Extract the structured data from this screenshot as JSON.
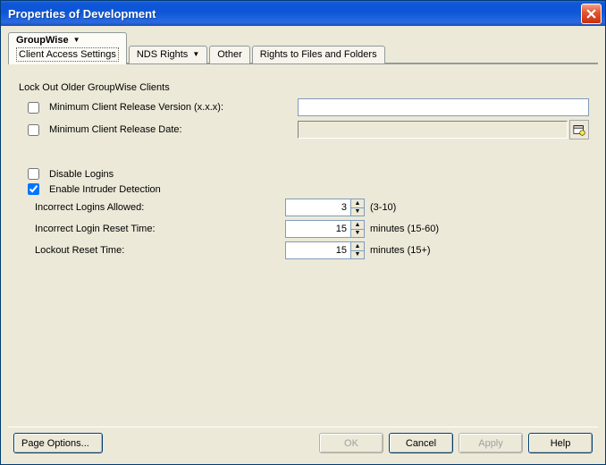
{
  "window": {
    "title": "Properties of Development"
  },
  "tabs": {
    "groupwise": {
      "label": "GroupWise",
      "subline": "Client Access Settings"
    },
    "nds": {
      "label": "NDS Rights"
    },
    "other": {
      "label": "Other"
    },
    "rights": {
      "label": "Rights to Files and Folders"
    }
  },
  "section": {
    "lockout_title": "Lock Out Older GroupWise Clients",
    "min_version_label": "Minimum Client Release Version (x.x.x):",
    "min_date_label": "Minimum Client Release Date:"
  },
  "checks": {
    "disable_logins": "Disable Logins",
    "enable_intruder": "Enable Intruder Detection"
  },
  "fields": {
    "incorrect_logins": {
      "label": "Incorrect Logins Allowed:",
      "value": "3",
      "suffix": "(3-10)"
    },
    "reset_time": {
      "label": "Incorrect Login Reset Time:",
      "value": "15",
      "suffix": "minutes (15-60)"
    },
    "lockout_reset": {
      "label": "Lockout Reset Time:",
      "value": "15",
      "suffix": "minutes (15+)"
    }
  },
  "buttons": {
    "page_options": "Page Options...",
    "ok": "OK",
    "cancel": "Cancel",
    "apply": "Apply",
    "help": "Help"
  },
  "inputs": {
    "min_version_value": "",
    "min_date_value": ""
  }
}
